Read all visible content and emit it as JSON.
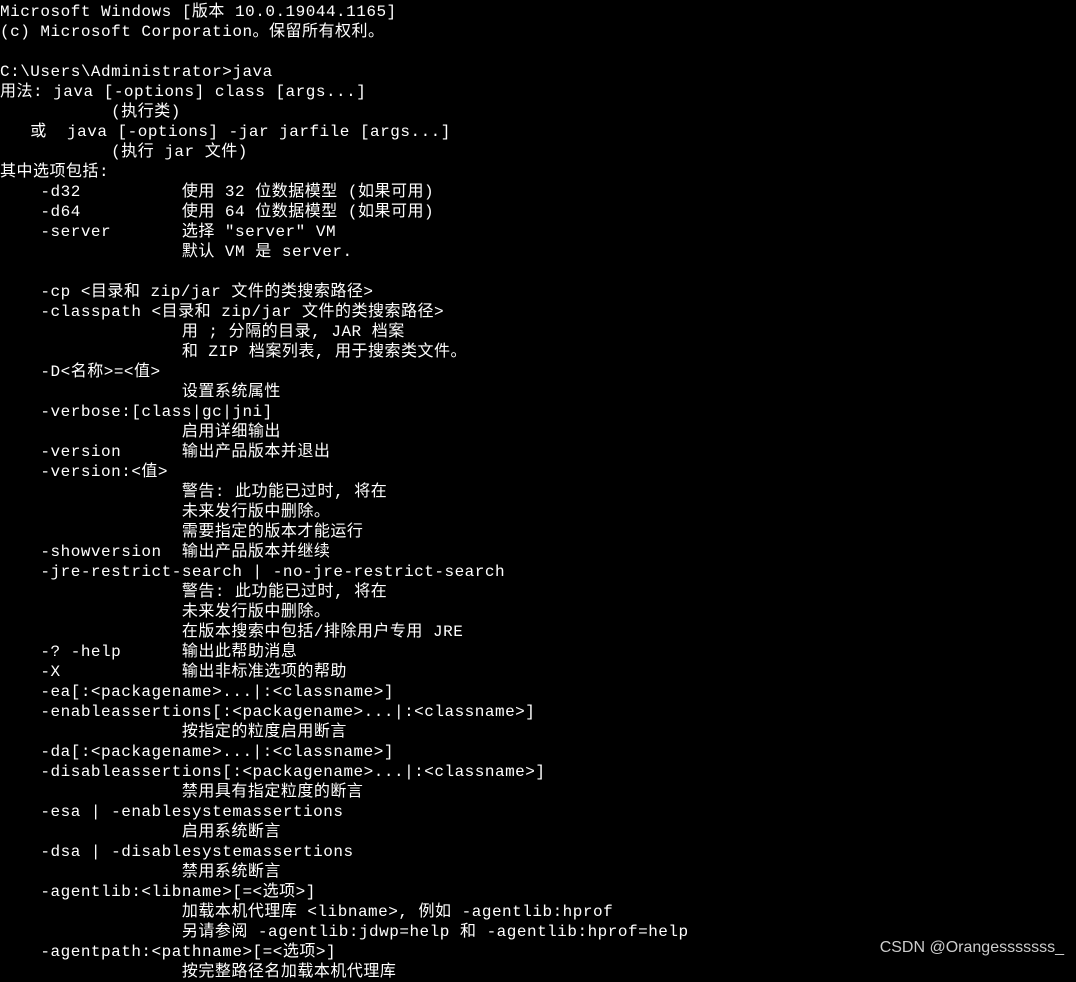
{
  "terminal": {
    "lines": [
      "Microsoft Windows [版本 10.0.19044.1165]",
      "(c) Microsoft Corporation。保留所有权利。",
      "",
      "C:\\Users\\Administrator>java",
      "用法: java [-options] class [args...]",
      "           (执行类)",
      "   或  java [-options] -jar jarfile [args...]",
      "           (执行 jar 文件)",
      "其中选项包括:",
      "    -d32          使用 32 位数据模型 (如果可用)",
      "    -d64          使用 64 位数据模型 (如果可用)",
      "    -server       选择 \"server\" VM",
      "                  默认 VM 是 server.",
      "",
      "    -cp <目录和 zip/jar 文件的类搜索路径>",
      "    -classpath <目录和 zip/jar 文件的类搜索路径>",
      "                  用 ; 分隔的目录, JAR 档案",
      "                  和 ZIP 档案列表, 用于搜索类文件。",
      "    -D<名称>=<值>",
      "                  设置系统属性",
      "    -verbose:[class|gc|jni]",
      "                  启用详细输出",
      "    -version      输出产品版本并退出",
      "    -version:<值>",
      "                  警告: 此功能已过时, 将在",
      "                  未来发行版中删除。",
      "                  需要指定的版本才能运行",
      "    -showversion  输出产品版本并继续",
      "    -jre-restrict-search | -no-jre-restrict-search",
      "                  警告: 此功能已过时, 将在",
      "                  未来发行版中删除。",
      "                  在版本搜索中包括/排除用户专用 JRE",
      "    -? -help      输出此帮助消息",
      "    -X            输出非标准选项的帮助",
      "    -ea[:<packagename>...|:<classname>]",
      "    -enableassertions[:<packagename>...|:<classname>]",
      "                  按指定的粒度启用断言",
      "    -da[:<packagename>...|:<classname>]",
      "    -disableassertions[:<packagename>...|:<classname>]",
      "                  禁用具有指定粒度的断言",
      "    -esa | -enablesystemassertions",
      "                  启用系统断言",
      "    -dsa | -disablesystemassertions",
      "                  禁用系统断言",
      "    -agentlib:<libname>[=<选项>]",
      "                  加载本机代理库 <libname>, 例如 -agentlib:hprof",
      "                  另请参阅 -agentlib:jdwp=help 和 -agentlib:hprof=help",
      "    -agentpath:<pathname>[=<选项>]",
      "                  按完整路径名加载本机代理库"
    ]
  },
  "watermark": "CSDN @Orangesssssss_"
}
